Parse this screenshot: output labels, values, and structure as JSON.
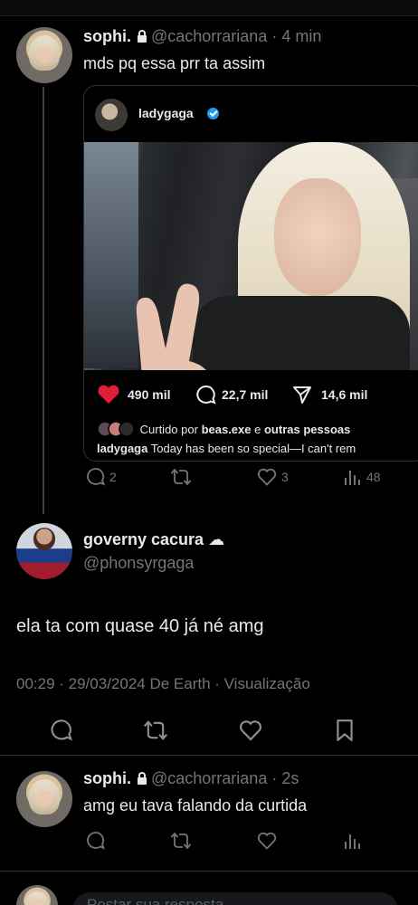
{
  "post1": {
    "display_name": "sophi.",
    "handle": "@cachorrariana",
    "time": "· 4 min",
    "text": "mds pq essa prr ta assim",
    "quote": {
      "account": "ladygaga",
      "stats": {
        "likes": "490 mil",
        "comments": "22,7 mil",
        "shares": "14,6 mil"
      },
      "liked_by_prefix": "Curtido por",
      "liked_by_user": "beas.exe",
      "liked_by_mid": "e",
      "liked_by_others": "outras pessoas",
      "caption_user": "ladygaga",
      "caption_text": "Today has been so special—I can't rem"
    },
    "actions": {
      "replies": "2",
      "retweets": "",
      "likes": "3",
      "views": "48"
    }
  },
  "post2": {
    "display_name": "governy cacura",
    "name_emoji": "☁",
    "handle": "@phonsyrgaga",
    "text": "ela ta com quase 40 já né amg",
    "meta": "00:29 · 29/03/2024 De Earth · Visualização"
  },
  "post3": {
    "display_name": "sophi.",
    "handle": "@cachorrariana",
    "time": "· 2s",
    "text": "amg eu tava falando da curtida"
  },
  "composer": {
    "placeholder": "Postar sua resposta"
  },
  "colors": {
    "background": "#000000",
    "text": "#e7e9ea",
    "muted": "#71767b",
    "like_red": "#f91880",
    "verified": "#1d9bf0"
  }
}
